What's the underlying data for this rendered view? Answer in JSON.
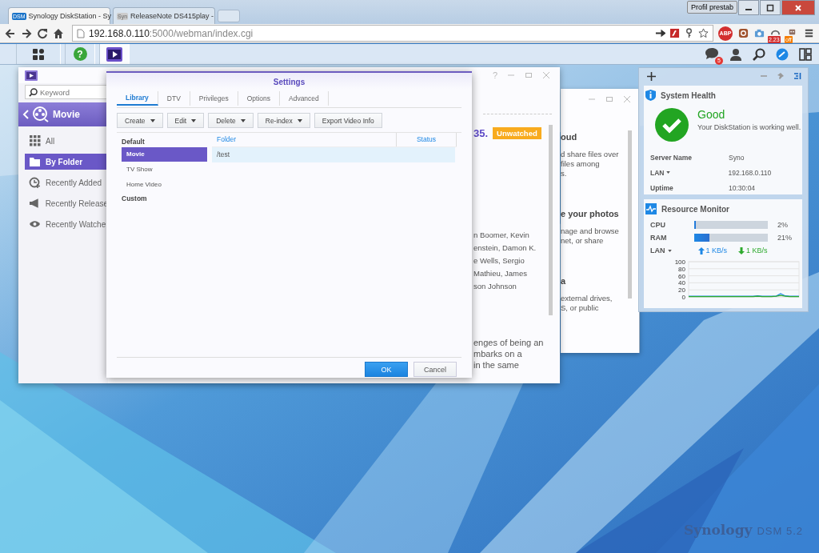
{
  "browser": {
    "tabs": [
      {
        "title": "Synology DiskStation - Sy",
        "favicon": "DSM",
        "selected": true
      },
      {
        "title": "ReleaseNote DS415play -",
        "favicon": "Syn",
        "selected": false
      }
    ],
    "profile": "Profil prestab",
    "url_host": "192.168.0.110",
    "url_rest": ":5000/webman/index.cgi",
    "extension_badges": [
      "ABP",
      "2.23",
      "off"
    ]
  },
  "taskbar": {
    "apps": [
      {
        "kind": "main-menu",
        "selected": false
      },
      {
        "kind": "help",
        "glyph": "?",
        "selected": false
      },
      {
        "kind": "video",
        "selected": true
      }
    ],
    "notification_count": "5"
  },
  "video_station": {
    "help_glyph": "?",
    "search": {
      "placeholder": "Keyword"
    },
    "section": "Movie",
    "nav": [
      {
        "label": "All",
        "selected": false
      },
      {
        "label": "By Folder",
        "selected": true
      },
      {
        "label": "Recently Added",
        "selected": false
      },
      {
        "label": "Recently Release",
        "selected": false
      },
      {
        "label": "Recently Watche",
        "selected": false
      }
    ],
    "title_fragment": "35.",
    "badge": "Unwatched",
    "cast_lines": [
      "n Boomer, Kevin",
      "enstein, Damon K.",
      "e Wells, Sergio",
      "Mathieu, James",
      "son Johnson"
    ],
    "description_lines": [
      "enges of being an",
      "mbarks on a",
      "in the same"
    ]
  },
  "background_window": {
    "blocks": [
      {
        "heading": "oud",
        "lines": [
          "d share files over",
          "files among",
          "s."
        ]
      },
      {
        "heading": "e your photos",
        "lines": [
          "nage and browse",
          "net, or share"
        ]
      },
      {
        "heading": "a",
        "lines": [
          "external drives,",
          "S, or public"
        ]
      }
    ]
  },
  "settings": {
    "title": "Settings",
    "tabs": [
      {
        "label": "Library",
        "selected": true
      },
      {
        "label": "DTV",
        "selected": false
      },
      {
        "label": "Privileges",
        "selected": false
      },
      {
        "label": "Options",
        "selected": false
      },
      {
        "label": "Advanced",
        "selected": false
      }
    ],
    "toolbar": [
      {
        "label": "Create",
        "menu": true
      },
      {
        "label": "Edit",
        "menu": true
      },
      {
        "label": "Delete",
        "menu": true
      },
      {
        "label": "Re-index",
        "menu": true
      },
      {
        "label": "Export Video Info",
        "menu": false
      }
    ],
    "groups": [
      {
        "label": "Default",
        "items": [
          {
            "label": "Movie",
            "selected": true
          },
          {
            "label": "TV Show",
            "selected": false
          },
          {
            "label": "Home Video",
            "selected": false
          }
        ]
      },
      {
        "label": "Custom"
      }
    ],
    "table": {
      "columns": [
        "Folder",
        "Status"
      ],
      "rows": [
        {
          "folder": "/test",
          "selected": true
        }
      ]
    },
    "buttons": [
      {
        "label": "OK",
        "kind": "primary"
      },
      {
        "label": "Cancel",
        "kind": "secondary"
      }
    ]
  },
  "widgets": {
    "system_health": {
      "title": "System Health",
      "status": "Good",
      "message": "Your DiskStation is working well.",
      "info": [
        {
          "label": "Server Name",
          "value": "Syno",
          "dropdown": false
        },
        {
          "label": "LAN",
          "value": "192.168.0.110",
          "dropdown": true
        },
        {
          "label": "Uptime",
          "value": "10:30:04",
          "dropdown": false
        }
      ]
    },
    "resource_monitor": {
      "title": "Resource Monitor",
      "meters": [
        {
          "label": "CPU",
          "level": 0.02,
          "reading": "2%"
        },
        {
          "label": "RAM",
          "level": 0.21,
          "reading": "21%"
        }
      ],
      "network_label": "LAN",
      "upload": "1 KB/s",
      "download": "1 KB/s",
      "chart_data": {
        "type": "line",
        "ylim": [
          0,
          100
        ],
        "yticks": [
          0,
          20,
          40,
          60,
          80,
          100
        ],
        "grid": true,
        "series": [
          {
            "color": "#1e88e5",
            "values": [
              2,
              2,
              2,
              2,
              2,
              2,
              2,
              2,
              2,
              2,
              2,
              2,
              2,
              2,
              2,
              3,
              2,
              2,
              2,
              2,
              9,
              3,
              2,
              2,
              2
            ]
          },
          {
            "color": "#2eaa2e",
            "values": [
              1,
              1,
              1,
              1,
              1,
              1,
              1,
              1,
              1,
              1,
              1,
              1,
              1,
              1,
              1,
              2,
              1,
              1,
              1,
              2,
              4,
              2,
              1,
              1,
              1
            ]
          }
        ]
      }
    }
  },
  "desktop_logo": {
    "brand": "Synology",
    "version": "DSM 5.2"
  }
}
